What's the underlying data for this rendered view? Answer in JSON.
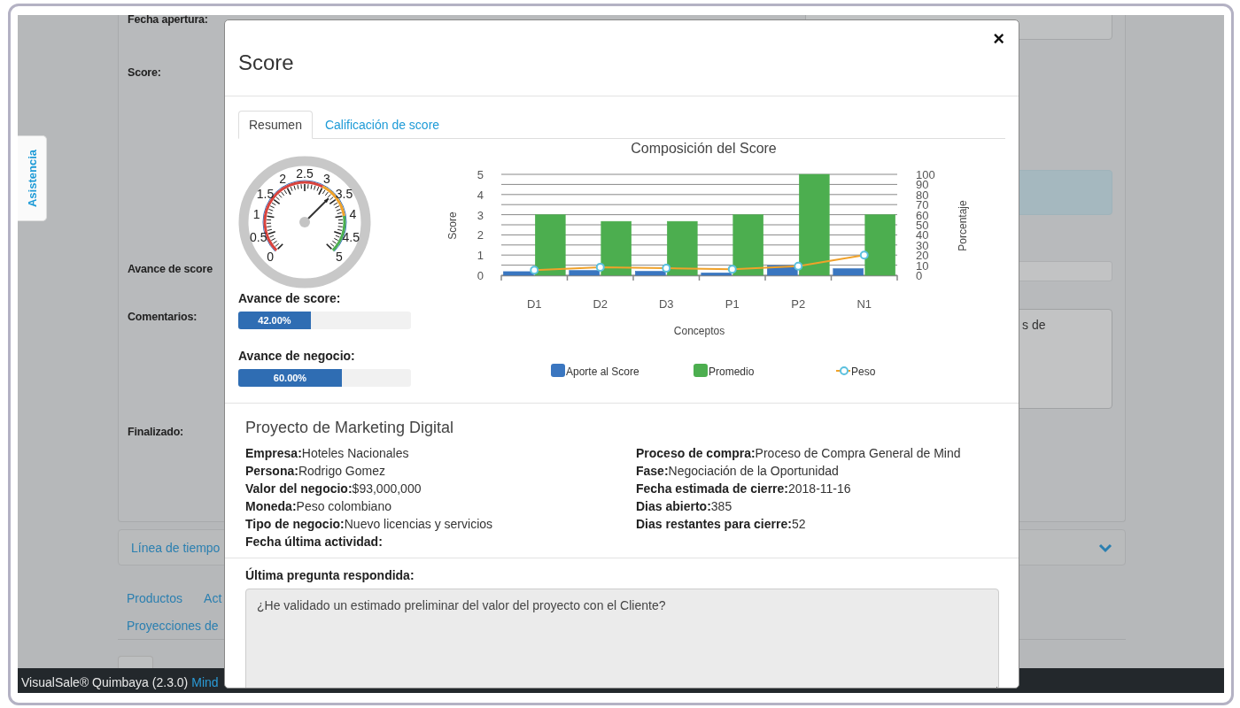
{
  "background": {
    "assist_tab": "Asistencia",
    "labels": [
      "Fecha apertura:",
      "Score:",
      "Avance de score",
      "Comentarios:",
      "Finalizado:"
    ],
    "comment_text": "s de",
    "timeline": "Línea de tiempo",
    "links": [
      [
        "Productos",
        "Act"
      ],
      [
        "Proyecciones de"
      ]
    ],
    "footer": {
      "product": "VisualSale® Quimbaya (2.3.0)",
      "link": "Mind"
    }
  },
  "modal": {
    "title": "Score",
    "close": "×",
    "tabs": [
      {
        "label": "Resumen",
        "selected": true
      },
      {
        "label": "Calificación de score",
        "selected": false
      }
    ],
    "gauge": {
      "labels": [
        "0",
        "0.5",
        "1",
        "1.5",
        "2",
        "2.5",
        "3",
        "3.5",
        "4",
        "4.5",
        "5"
      ],
      "level": 0.667
    },
    "progress": [
      {
        "label": "Avance de score:",
        "level": 0.42,
        "reading": "42.00%"
      },
      {
        "label": "Avance de negocio:",
        "level": 0.6,
        "reading": "60.00%"
      }
    ],
    "chart_data": {
      "type": "bar",
      "title": "Composición del Score",
      "xlabel": "Conceptos",
      "ylabel": "Score",
      "categories": [
        "D1",
        "D2",
        "D3",
        "P1",
        "P2",
        "N1"
      ],
      "ylim": [
        0,
        5
      ],
      "yticks": [
        0,
        1,
        2,
        3,
        4,
        5
      ],
      "grid": true,
      "legend": "bottom",
      "series": [
        {
          "name": "Aporte al Score",
          "type": "bar",
          "color": "#3a76c0",
          "values": [
            0.18,
            0.24,
            0.2,
            0.12,
            0.48,
            0.33
          ]
        },
        {
          "name": "Promedio",
          "type": "bar",
          "color": "#4cae4f",
          "values": [
            3,
            2.67,
            2.67,
            3,
            5,
            3
          ]
        },
        {
          "name": "Peso",
          "type": "line",
          "color": "#f0a22a",
          "marker": "o",
          "values": [
            0.25,
            0.4,
            0.35,
            0.3,
            0.45,
            1
          ]
        }
      ]
    },
    "right_axis": {
      "title": "Porcentaje",
      "ticks": [
        "100",
        "90",
        "80",
        "70",
        "60",
        "50",
        "40",
        "30",
        "20",
        "10",
        "0"
      ]
    },
    "project": {
      "title": "Proyecto de Marketing Digital",
      "left": [
        {
          "label": "Empresa:",
          "value": "Hoteles Nacionales"
        },
        {
          "label": "Persona:",
          "value": "Rodrigo Gomez"
        },
        {
          "label": "Valor del negocio:",
          "value": "$93,000,000"
        },
        {
          "label": "Moneda:",
          "value": "Peso colombiano"
        },
        {
          "label": "Tipo de negocio:",
          "value": "Nuevo licencias y servicios"
        },
        {
          "label": "Fecha última actividad:"
        }
      ],
      "right": [
        {
          "label": "Proceso de compra:",
          "value": "Proceso de Compra General de Mind"
        },
        {
          "label": "Fase:",
          "value": "Negociación de la Oportunidad"
        },
        {
          "label": "Fecha estimada de cierre:",
          "value": "2018-11-16"
        },
        {
          "label": "Dias abierto:",
          "value": "385"
        },
        {
          "label": "Dias restantes para cierre:",
          "value": "52"
        }
      ]
    },
    "question": {
      "label": "Última pregunta respondida:",
      "value": "¿He validado un estimado preliminar del valor del proyecto con el Cliente?"
    }
  }
}
